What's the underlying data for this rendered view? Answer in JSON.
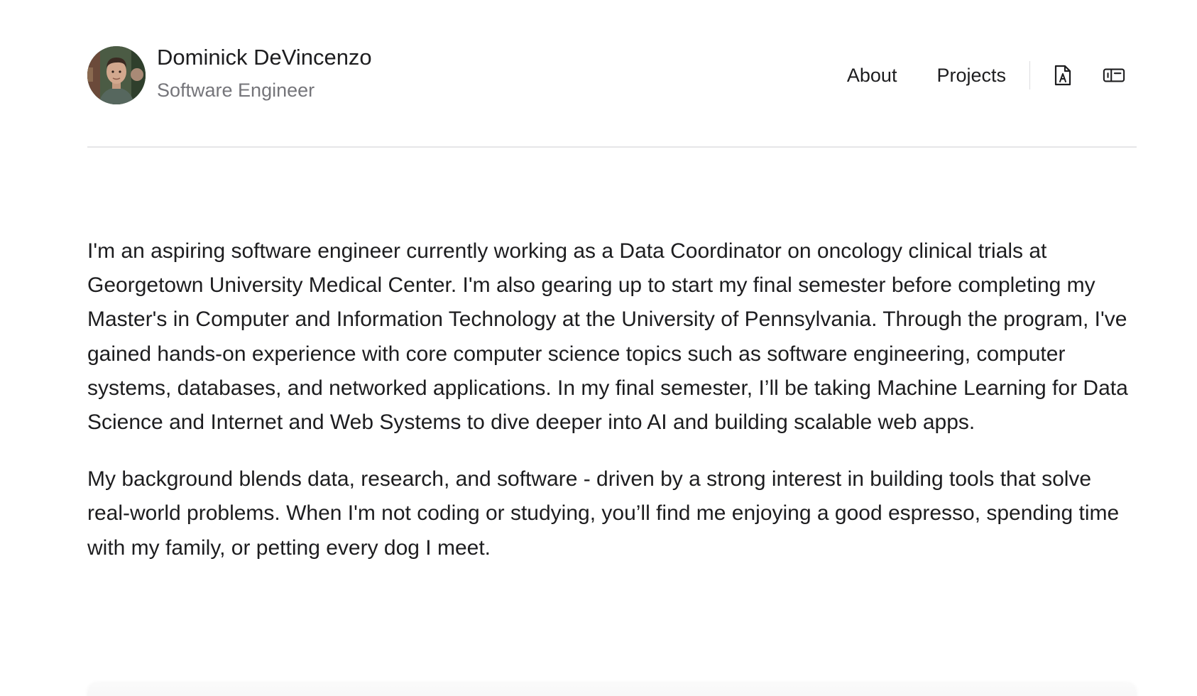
{
  "header": {
    "name": "Dominick DeVincenzo",
    "role": "Software Engineer",
    "avatar_icon": "avatar-photo"
  },
  "nav": {
    "links": [
      "About",
      "Projects"
    ],
    "icons": [
      "resume-file-icon",
      "id-card-icon"
    ]
  },
  "about": {
    "paragraphs": [
      "I'm an aspiring software engineer currently working as a Data Coordinator on oncology clinical trials at Georgetown University Medical Center. I'm also gearing up to start my final semester before completing my Master's in Computer and Information Technology at the University of Pennsylvania. Through the program, I've gained hands-on experience with core computer science topics such as software engineering, computer systems, databases, and networked applications. In my final semester, I’ll be taking Machine Learning for Data Science and Internet and Web Systems to dive deeper into AI and building scalable web apps.",
      "My background blends data, research, and software - driven by a strong interest in building tools that solve real-world problems. When I'm not coding or studying, you’ll find me enjoying a good espresso, spending time with my family, or petting every dog I meet."
    ]
  },
  "colors": {
    "text": "#1d1d1f",
    "muted": "#75757a",
    "divider": "#e6e6e8",
    "background": "#ffffff"
  }
}
